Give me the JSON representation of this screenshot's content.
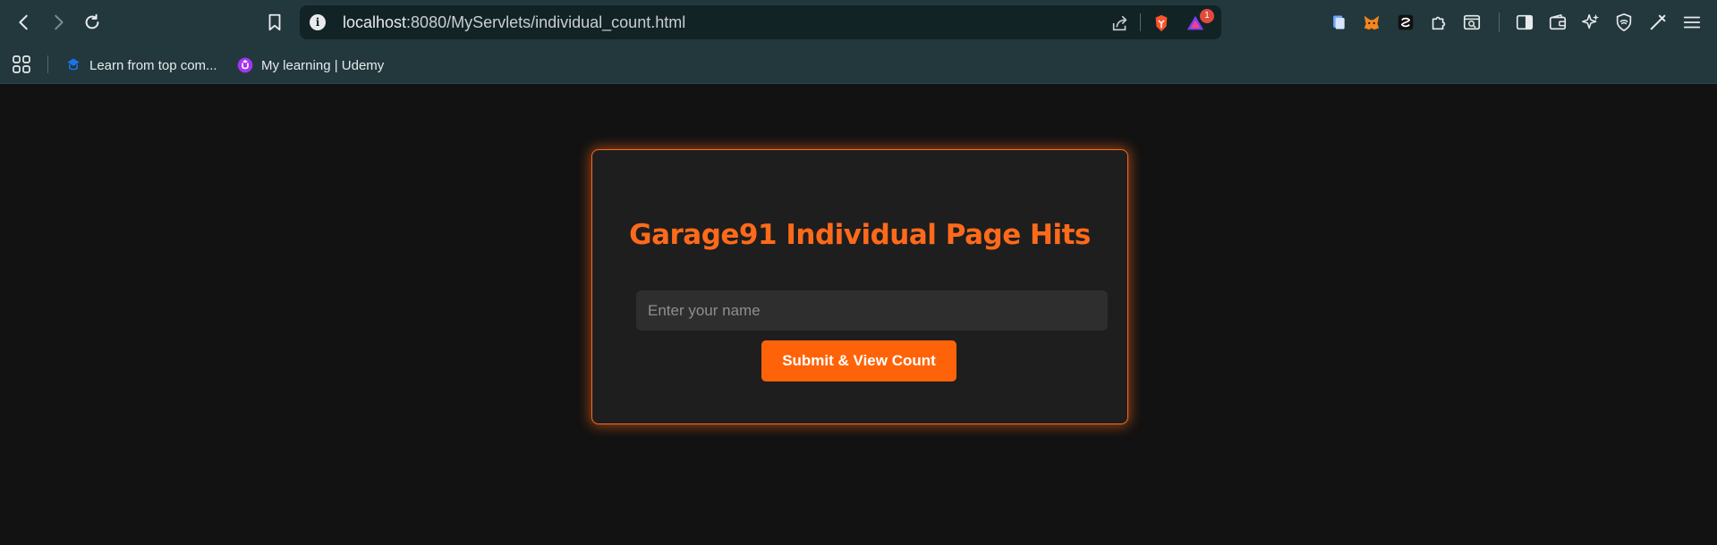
{
  "browser": {
    "url_host": "localhost",
    "url_path": ":8080/MyServlets/individual_count.html",
    "notification_count": "1",
    "bookmarks": [
      {
        "label": "Learn from top com..."
      },
      {
        "label": "My learning | Udemy"
      }
    ]
  },
  "page": {
    "title": "Garage91 Individual Page Hits",
    "name_placeholder": "Enter your name",
    "name_value": "",
    "submit_label": "Submit & View Count"
  },
  "colors": {
    "accent": "#ff6a1a",
    "chrome_bg": "#22383d",
    "page_bg": "#121212",
    "card_bg": "#1e1e1e"
  }
}
